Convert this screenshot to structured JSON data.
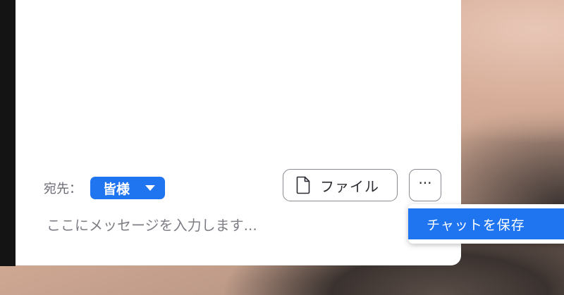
{
  "chat": {
    "recipient_label": "宛先：",
    "recipient_value": "皆様",
    "file_button_label": "ファイル",
    "more_button_label": "···",
    "message_placeholder": "ここにメッセージを入力します..."
  },
  "more_menu": {
    "items": [
      {
        "label": "チャットを保存",
        "highlighted": true
      }
    ]
  },
  "icons": {
    "file_icon": "document-icon",
    "recipient_caret": "caret-down-icon",
    "more_icon": "ellipsis-icon"
  },
  "colors": {
    "accent": "#1f74f0",
    "panel_background": "#ffffff",
    "button_border": "#8a8a92",
    "placeholder_text": "#7e7e86"
  }
}
